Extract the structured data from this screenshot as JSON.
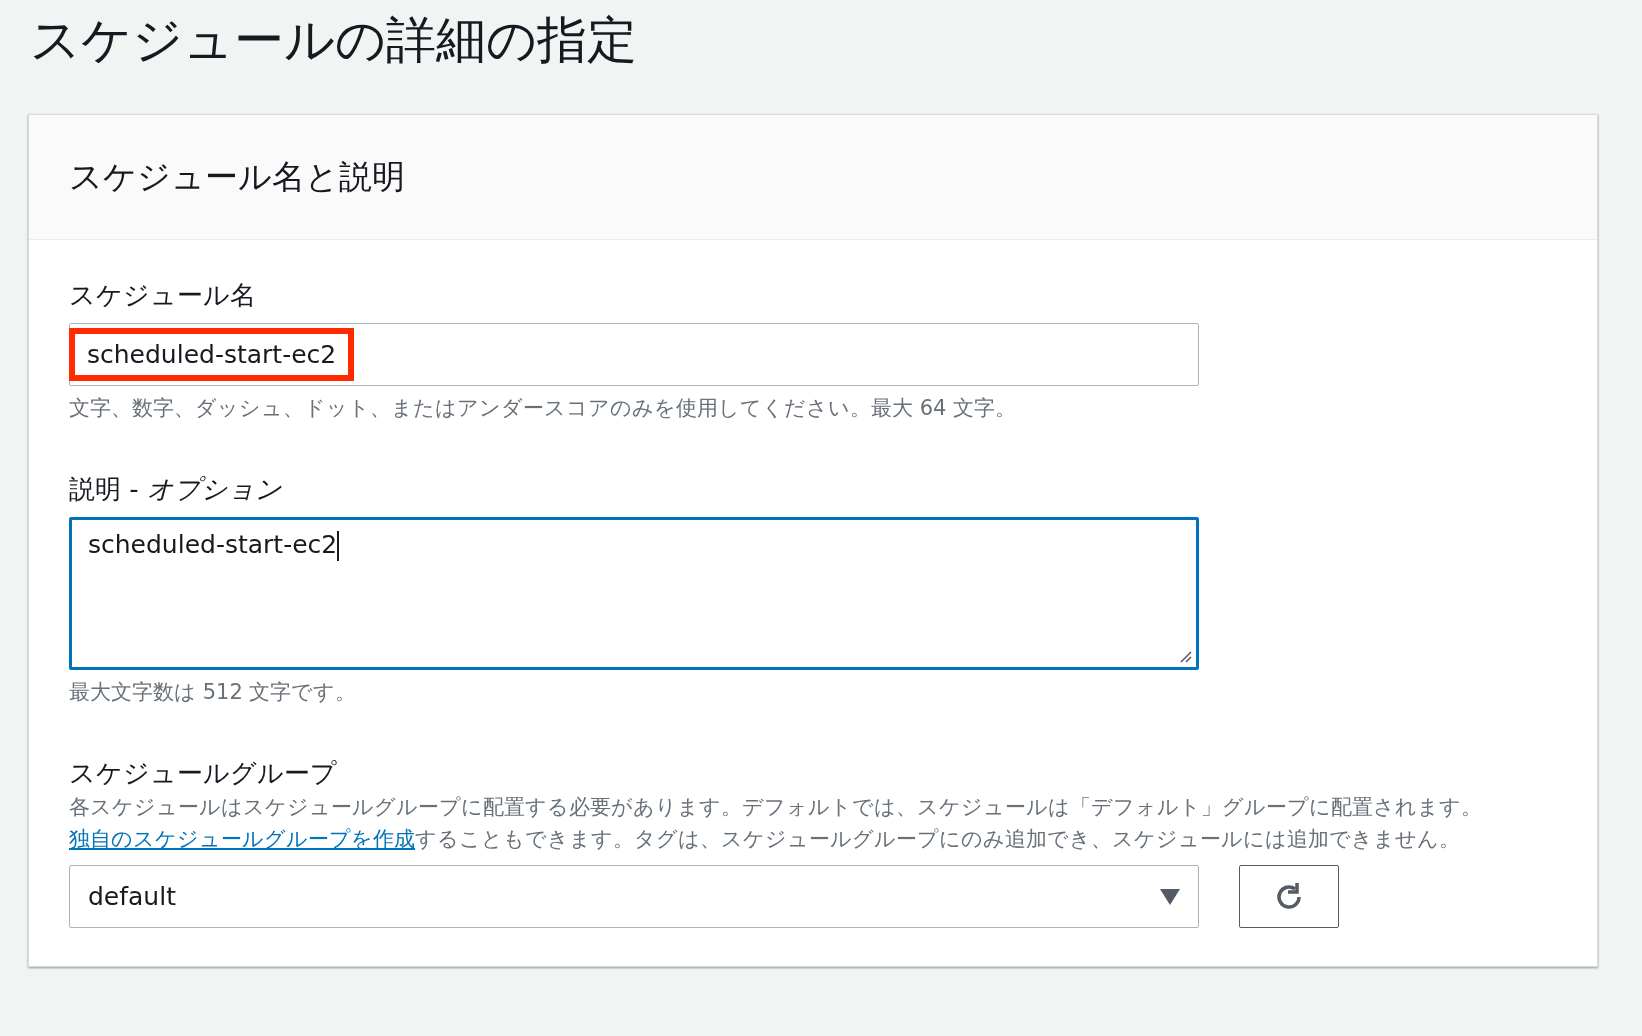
{
  "page_title": "スケジュールの詳細の指定",
  "card": {
    "title": "スケジュール名と説明",
    "fields": [
      {
        "kind": "input",
        "label": "スケジュール名",
        "value": "scheduled-start-ec2",
        "highlighted": true,
        "focused": false,
        "hint": "文字、数字、ダッシュ、ドット、またはアンダースコアのみを使用してください。最大 64 文字。"
      },
      {
        "kind": "textarea",
        "label": "説明 - ",
        "label_suffix": "オプション",
        "value": "scheduled-start-ec2",
        "highlighted": false,
        "focused": true,
        "hint": "最大文字数は 512 文字です。"
      }
    ],
    "group": {
      "label": "スケジュールグループ",
      "description_before": "各スケジュールはスケジュールグループに配置する必要があります。デフォルトでは、スケジュールは「デフォルト」グループに配置されます。",
      "description_link": "独自のスケジュールグループを作成",
      "description_after": "することもできます。タグは、スケジュールグループにのみ追加でき、スケジュールには追加できません。",
      "value": "default"
    }
  }
}
